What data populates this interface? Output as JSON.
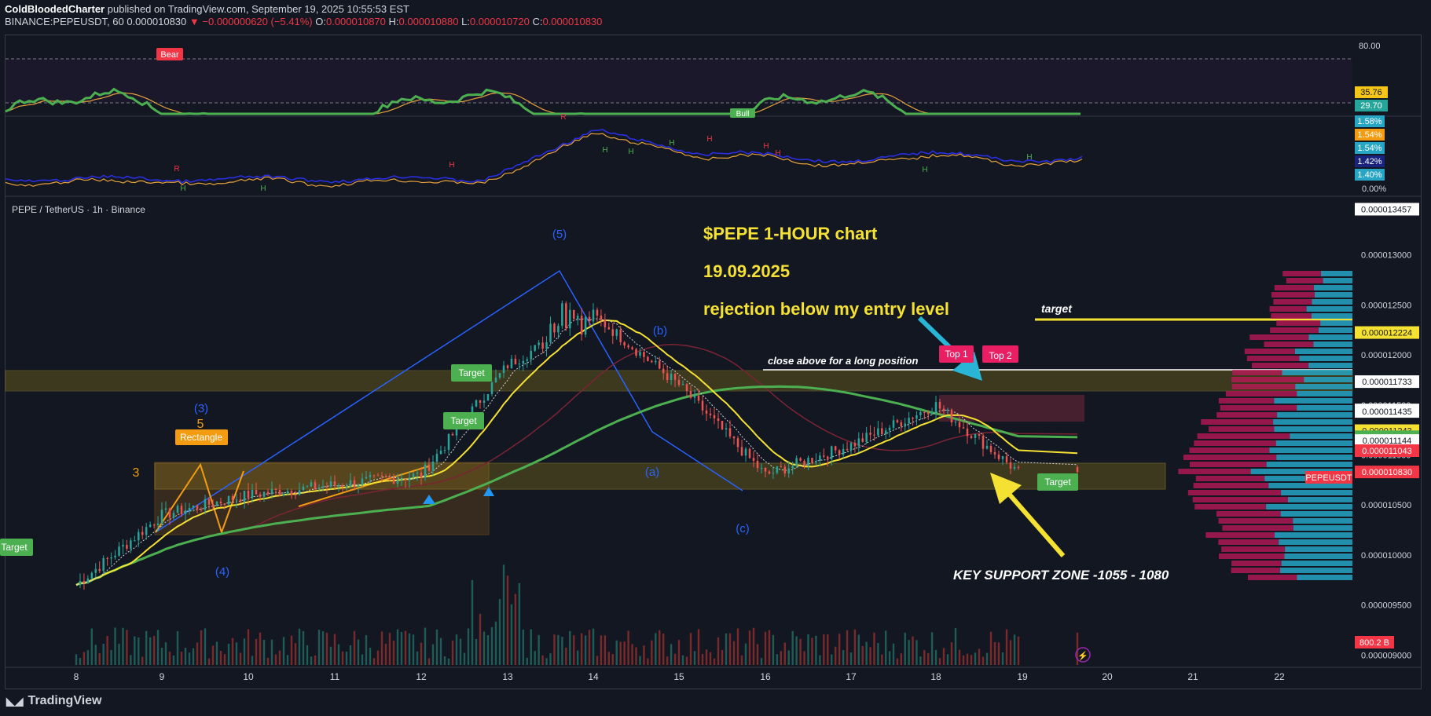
{
  "header": {
    "author": "ColdBloodedCharter",
    "published": "published on TradingView.com, September 19, 2025 10:55:53 EST",
    "symbol_line": "BINANCE:PEPEUSDT, 60",
    "last": "0.000010830",
    "change": "−0.000000620 (−5.41%)",
    "o_label": "O:",
    "o": "0.000010870",
    "h_label": "H:",
    "h": "0.000010880",
    "l_label": "L:",
    "l": "0.000010720",
    "c_label": "C:",
    "c": "0.000010830"
  },
  "rsi_pane": {
    "level_80": "80.00",
    "badges": [
      "35.76",
      "29.70"
    ],
    "bear_label": "Bear",
    "bull_label": "Bull",
    "colors": {
      "rsi": "#4caf50",
      "ma": "#e6a23c",
      "badge_orange": "#f5c518",
      "badge_green": "#26a69a"
    }
  },
  "mid_pane": {
    "badges": [
      "1.58%",
      "1.54%",
      "1.54%",
      "1.42%",
      "1.40%"
    ],
    "bottom": "0.00%",
    "letters": [
      "R",
      "H",
      "H",
      "H",
      "R",
      "H",
      "H",
      "H",
      "H",
      "H",
      "H",
      "H",
      "H"
    ]
  },
  "main": {
    "title": "PEPE / TetherUS · 1h · Binance",
    "annotation_1": "$PEPE    1-HOUR chart",
    "annotation_2": "19.09.2025",
    "annotation_3": "rejection below my entry level",
    "target_text": "target",
    "close_above": "close above for a long position",
    "key_support": "KEY SUPPORT ZONE -1055 - 1080",
    "rectangle_label": "Rectangle",
    "top1": "Top 1",
    "top2": "Top 2",
    "target_labels": [
      "Target",
      "Target",
      "Target",
      "Target"
    ],
    "wave_labels": [
      "(5)",
      "(b)",
      "(3)",
      "(a)",
      "(c)",
      "(4)",
      "3",
      "5"
    ],
    "price_axis": [
      "0.000013457",
      "0.000013000",
      "0.000012500",
      "0.000012000",
      "0.000011500",
      "0.000011000",
      "0.000010500",
      "0.000010000",
      "0.000009500",
      "0.000009000"
    ],
    "price_badges": [
      {
        "text": "0.000012224",
        "color": "#f5e132"
      },
      {
        "text": "0.000011733",
        "color": "#ffffff"
      },
      {
        "text": "0.000011450",
        "color": "#ffffff"
      },
      {
        "text": "0.000011435",
        "color": "#ffffff"
      },
      {
        "text": "0.000011243",
        "color": "#f5e132"
      },
      {
        "text": "0.000011182",
        "color": "#4caf50"
      },
      {
        "text": "0.000011144",
        "color": "#ffffff"
      },
      {
        "text": "0.000011043",
        "color": "#f23645"
      },
      {
        "text": "0.000010830",
        "color": "#f23645"
      }
    ],
    "symbol_badge": "PEPEUSDT",
    "volume_badge": "800.2 B",
    "time_axis": [
      "8",
      "9",
      "10",
      "11",
      "12",
      "13",
      "14",
      "15",
      "16",
      "17",
      "18",
      "19",
      "20",
      "21",
      "22"
    ]
  },
  "chart_data": {
    "type": "line",
    "title": "$PEPE 1-HOUR chart",
    "xlabel": "",
    "ylabel": "",
    "x": [
      "8",
      "9",
      "10",
      "11",
      "12",
      "13",
      "14",
      "15",
      "16",
      "17",
      "18",
      "19"
    ],
    "series": [
      {
        "values": [
          9.7e-06,
          1.04e-05,
          1.06e-05,
          1.07e-05,
          1.08e-05,
          1.19e-05,
          1.24e-05,
          1.17e-05,
          1.08e-05,
          1.11e-05,
          1.15e-05,
          1.08e-05
        ]
      }
    ],
    "ylim": [
      8.9e-06,
      1.35e-05
    ],
    "support_zone": [
      1.055e-05,
      1.08e-05
    ],
    "resistance_zone": [
      1.14e-05,
      1.18e-05
    ],
    "target_level": 1.2224e-05,
    "last_price": 1.083e-05
  },
  "footer": {
    "brand": "TradingView"
  }
}
